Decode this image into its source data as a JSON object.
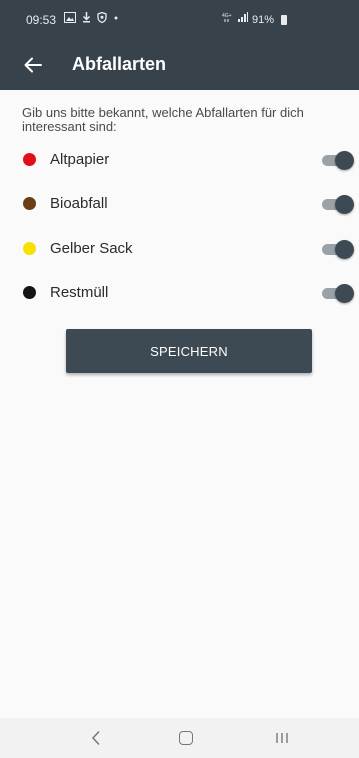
{
  "status_bar": {
    "time": "09:53",
    "left_icons": [
      "gallery-icon",
      "download-icon",
      "shield-icon",
      "dot-icon"
    ],
    "right_icons": [
      "4g-icon",
      "signal-icon"
    ],
    "battery_percent": "91%"
  },
  "app_bar": {
    "title": "Abfallarten",
    "back_icon": "arrow-left-icon",
    "background_color": "#37424a"
  },
  "intro_text": "Gib uns bitte bekannt, welche Abfallarten für dich interessant sind:",
  "waste_types": [
    {
      "label": "Altpapier",
      "color": "#e0101b",
      "enabled": true
    },
    {
      "label": "Bioabfall",
      "color": "#6b3e17",
      "enabled": true
    },
    {
      "label": "Gelber Sack",
      "color": "#f5e200",
      "enabled": true
    },
    {
      "label": "Restmüll",
      "color": "#151515",
      "enabled": true
    }
  ],
  "save_button": {
    "label": "SPEICHERN"
  },
  "nav_bar": {
    "back_icon": "chevron-left-icon",
    "home_icon": "home-icon",
    "recent_icon": "recent-apps-icon"
  }
}
